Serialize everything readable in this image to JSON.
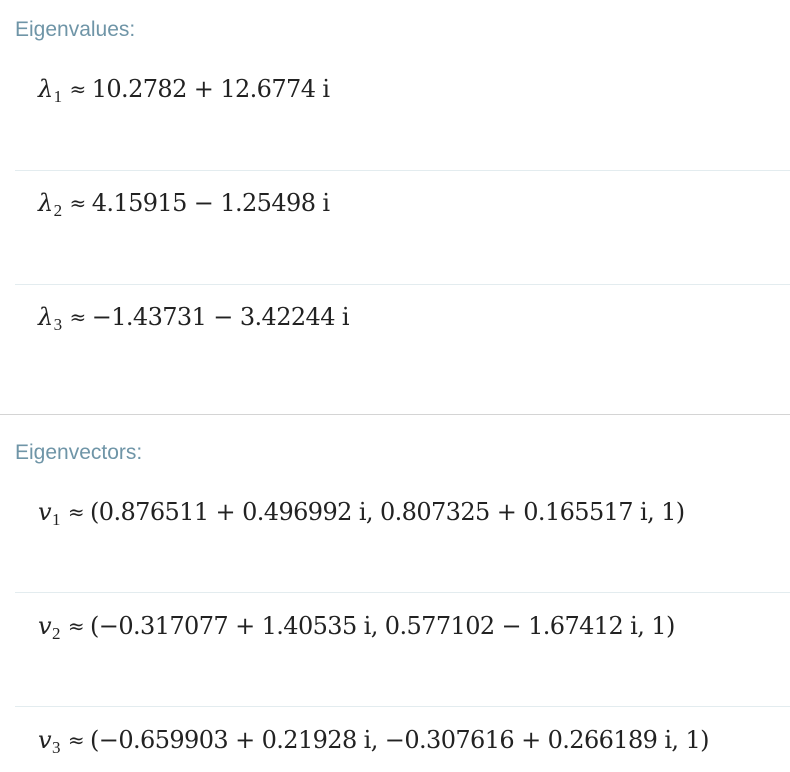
{
  "eigenvalues": {
    "title": "Eigenvalues:",
    "rows": [
      {
        "symbol": "λ",
        "index": "1",
        "relation": "≈",
        "value": "10.2782 + 12.6774 i"
      },
      {
        "symbol": "λ",
        "index": "2",
        "relation": "≈",
        "value": "4.15915 − 1.25498 i"
      },
      {
        "symbol": "λ",
        "index": "3",
        "relation": "≈",
        "value": "−1.43731 − 3.42244 i"
      }
    ]
  },
  "eigenvectors": {
    "title": "Eigenvectors:",
    "rows": [
      {
        "symbol": "v",
        "index": "1",
        "relation": "≈",
        "value": "(0.876511 + 0.496992 i, 0.807325 + 0.165517 i, 1)"
      },
      {
        "symbol": "v",
        "index": "2",
        "relation": "≈",
        "value": "(−0.317077 + 1.40535 i, 0.577102 − 1.67412 i, 1)"
      },
      {
        "symbol": "v",
        "index": "3",
        "relation": "≈",
        "value": "(−0.659903 + 0.21928 i, −0.307616 + 0.266189 i, 1)"
      }
    ]
  }
}
